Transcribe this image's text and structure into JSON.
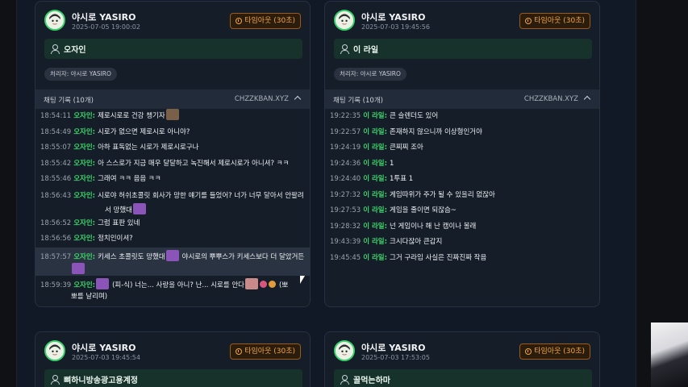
{
  "cards": [
    {
      "user_name": "야시로 YASIRO",
      "date": "2025-07-05 19:00:02",
      "timeout_label": "타임아웃 (30초)",
      "target": "오자인",
      "handler_label": "처리자: 야시로 YASIRO",
      "log_title": "채팅 기록 (10개)",
      "log_source": "CHZZKBAN.XYZ"
    },
    {
      "user_name": "야시로 YASIRO",
      "date": "2025-07-03 19:45:56",
      "timeout_label": "타임아웃 (30초)",
      "target": "이 라일",
      "handler_label": "처리자: 야시로 YASIRO",
      "log_title": "채팅 기록 (10개)",
      "log_source": "CHZZKBAN.XYZ"
    },
    {
      "user_name": "야시로 YASIRO",
      "date": "2025-07-03 19:45:54",
      "timeout_label": "타임아웃 (30초)",
      "target": "뼈하니방송광고용계정"
    },
    {
      "user_name": "야시로 YASIRO",
      "date": "2025-07-03 17:53:05",
      "timeout_label": "타임아웃 (30초)",
      "target": "꿀먹는하마"
    }
  ],
  "chat_left": [
    {
      "time": "18:54:11",
      "name": "오자인:",
      "msg": "제로시로로 건강 챙기자"
    },
    {
      "time": "18:54:49",
      "name": "오자인:",
      "msg": "시로가 없으면 제로시로 아니야?"
    },
    {
      "time": "18:55:07",
      "name": "오자인:",
      "msg": "아하 표독없는 시로가 제로시로구나"
    },
    {
      "time": "18:55:42",
      "name": "오자인:",
      "msg": "아 스스로가 지금 매우 달달하고 녹진해서 제로시로가 아니셔? ㅋㅋ"
    },
    {
      "time": "18:55:46",
      "name": "오자인:",
      "msg": "그래여 ㅋㅋ 음음 ㅋㅋ"
    },
    {
      "time": "18:56:43",
      "name": "오자인:",
      "msg": "시로야 허쉬초콜릿 회사가 망한 얘기를 들었어? 너가 너무 달아서 안팔려",
      "wrap": "서 망했대"
    },
    {
      "time": "18:56:52",
      "name": "오자인:",
      "msg": "그럼 표판 있네"
    },
    {
      "time": "18:56:56",
      "name": "오자인:",
      "msg": "정치인이셔?"
    },
    {
      "time": "18:57:57",
      "name": "오자인:",
      "msg": "키세스 초콜릿도 망했대",
      "msg2": "야시로의 뿌뿌스가 키세스보다 더 달았거든"
    },
    {
      "time": "18:59:39",
      "name": "오자인:",
      "msg": "(피-식) 너는... 사랑을 아니? 난... 시로를 안다",
      "msg2": "(뽀",
      "wrap": "뽀를 날리며)"
    }
  ],
  "chat_right": [
    {
      "time": "19:22:35",
      "name": "이 라일:",
      "msg": "큰 슬렌더도 있어"
    },
    {
      "time": "19:22:57",
      "name": "이 라일:",
      "msg": "존재하지 않으니까 이상형인거야"
    },
    {
      "time": "19:24:19",
      "name": "이 라일:",
      "msg": "큰찌찌 조아"
    },
    {
      "time": "19:24:36",
      "name": "이 라일:",
      "msg": "1"
    },
    {
      "time": "19:24:40",
      "name": "이 라일:",
      "msg": "1투표 1"
    },
    {
      "time": "19:27:32",
      "name": "이 라일:",
      "msg": "게임따위가 주가 될 수 있을리 없잖아"
    },
    {
      "time": "19:27:53",
      "name": "이 라일:",
      "msg": "게임을 줄이면 되잖슴~"
    },
    {
      "time": "19:28:32",
      "name": "이 라일:",
      "msg": "넌 게임이나 해 난 캠이나 볼래"
    },
    {
      "time": "19:43:39",
      "name": "이 라일:",
      "msg": "크시다잖아 큰갑지"
    },
    {
      "time": "19:45:45",
      "name": "이 라일:",
      "msg": "그거 구라임 사실은 진짜진짜 작음"
    }
  ],
  "colors": {
    "accent_green": "#3ed86a",
    "timeout_orange": "#f6a440"
  },
  "icons": [
    "user-avatar",
    "clock-icon",
    "person-icon",
    "chevron-up-icon",
    "emote-icon"
  ]
}
